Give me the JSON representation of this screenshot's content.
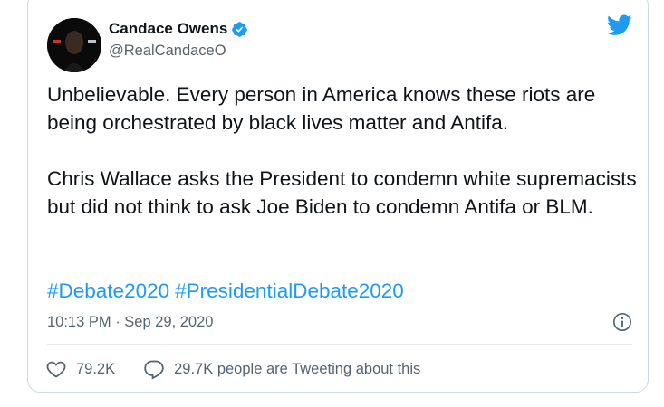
{
  "tweet": {
    "author": {
      "name": "Candace Owens",
      "handle": "@RealCandaceO",
      "verified": true
    },
    "text": "Unbelievable. Every person in America knows these riots are being orchestrated by black lives matter and Antifa.\n\nChris Wallace asks the President to condemn white supremacists but did not think to ask Joe Biden to condemn Antifa or BLM.",
    "hashtags": [
      "#Debate2020",
      "#PresidentialDebate2020"
    ],
    "timestamp": "10:13 PM · Sep 29, 2020",
    "likes": "79.2K",
    "tweeting_count": "29.7K people are Tweeting about this"
  },
  "colors": {
    "accent": "#1d9bf0",
    "text": "#0f1419",
    "secondary_text": "#536471",
    "border": "#cfd9de"
  },
  "icons": {
    "brand": "twitter-bird-icon",
    "verified": "verified-badge-icon",
    "info": "info-icon",
    "like": "heart-icon",
    "reply": "speech-bubble-icon"
  }
}
